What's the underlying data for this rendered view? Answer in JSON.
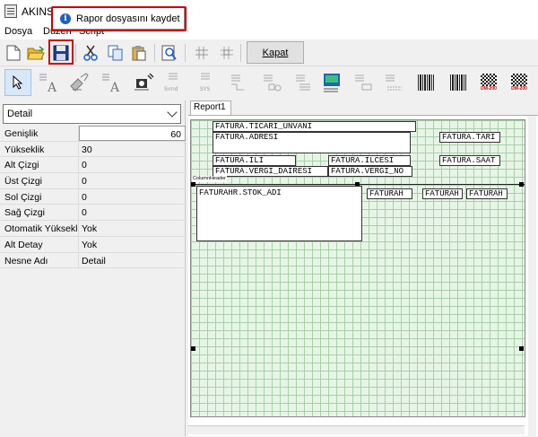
{
  "window": {
    "title": "AKINSO"
  },
  "menu": {
    "items": [
      "Dosya",
      "Düzen",
      "Script"
    ]
  },
  "tooltip": {
    "text": "Rapor dosyasını kaydet"
  },
  "toolbar1": {
    "close_label": "Kapat"
  },
  "toolbar2": {
    "barcode_labels": [
      "DM-200",
      "DM-200"
    ],
    "field_caps": [
      "Sırnd",
      "SYS"
    ]
  },
  "object_selector": {
    "selected": "Detail"
  },
  "properties": [
    {
      "name": "Genişlik",
      "value": "60"
    },
    {
      "name": "Yükseklik",
      "value": "30"
    },
    {
      "name": "Alt Çizgi",
      "value": "0"
    },
    {
      "name": "Üst Çizgi",
      "value": "0"
    },
    {
      "name": "Sol Çizgi",
      "value": "0"
    },
    {
      "name": "Sağ Çizgi",
      "value": "0"
    },
    {
      "name": "Otomatik Yükseklik",
      "value": "Yok"
    },
    {
      "name": "Alt Detay",
      "value": "Yok"
    },
    {
      "name": "Nesne Adı",
      "value": "Detail"
    }
  ],
  "tabs": [
    {
      "label": "Report1"
    }
  ],
  "report": {
    "band_label": "ColumnHeader",
    "fields": [
      "FATURA.TICARI_UNVANI",
      "FATURA.ADRESI",
      "FATURA.TARI",
      "FATURA.ILI",
      "FATURA.ILCESI",
      "FATURA.SAAT",
      "FATURA.VERGI_DAIRESI",
      "FATURA.VERGI_NO",
      "FATURAHR.STOK_ADI",
      "FATURAH",
      "FATURAH",
      "FATURAH"
    ]
  }
}
